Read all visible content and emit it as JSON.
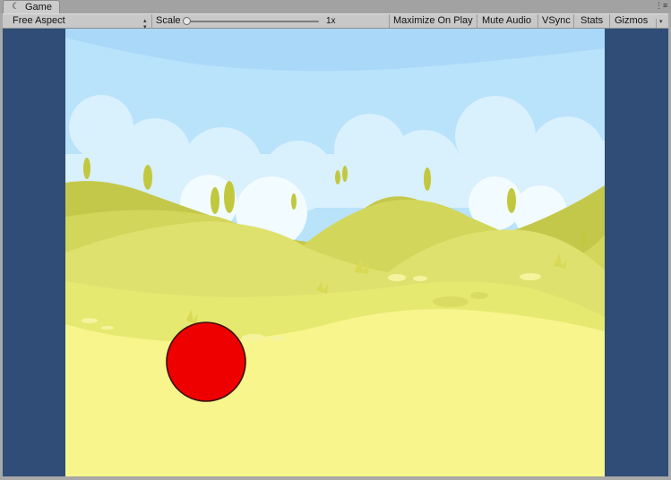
{
  "window": {
    "tab_title": "Game",
    "tab_icon": "unity-game-icon",
    "menu_icon": "tab-menu-icon"
  },
  "toolbar": {
    "aspect_label": "Free Aspect",
    "scale_label": "Scale",
    "scale_value": "1x",
    "scale_slider_value": 0,
    "maximize_label": "Maximize On Play",
    "mute_label": "Mute Audio",
    "vsync_label": "VSync",
    "stats_label": "Stats",
    "gizmos_label": "Gizmos"
  },
  "colors": {
    "letterbox": "#2f4d77",
    "sky": "#b9e2fb",
    "ball": "#ef0000",
    "ball_outline": "#3a1010",
    "ground": "#f7f58c"
  },
  "scene": {
    "objects": [
      "cartoon-hills-background",
      "red-ball"
    ]
  }
}
